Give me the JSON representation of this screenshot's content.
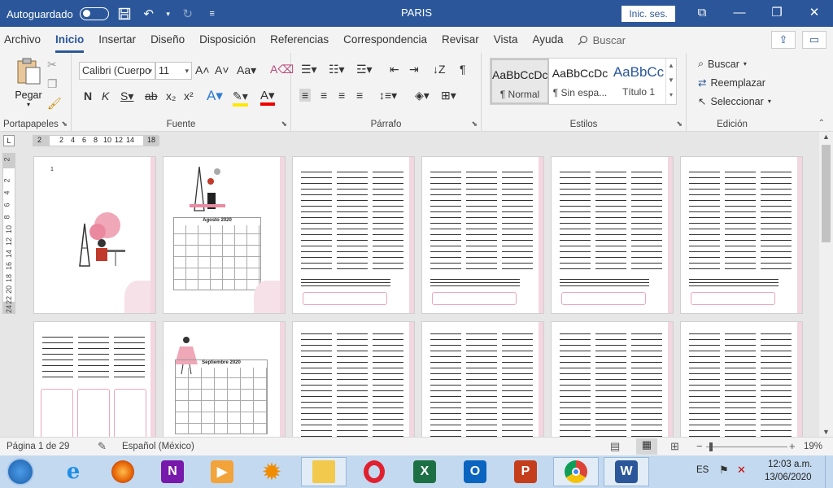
{
  "titlebar": {
    "autosave_label": "Autoguardado",
    "doc_title": "PARIS",
    "signin_label": "Inic. ses.",
    "min": "—",
    "restore": "❐",
    "close": "✕",
    "opts": "⧉"
  },
  "tabs": [
    "Archivo",
    "Inicio",
    "Insertar",
    "Diseño",
    "Disposición",
    "Referencias",
    "Correspondencia",
    "Revisar",
    "Vista",
    "Ayuda"
  ],
  "search_label": "Buscar",
  "ribbon": {
    "paste_label": "Pegar",
    "clipboard_group": "Portapapeles",
    "font_name": "Calibri (Cuerpo",
    "font_size": "11",
    "font_group": "Fuente",
    "paragraph_group": "Párrafo",
    "styles_group": "Estilos",
    "editing_group": "Edición",
    "styles": [
      {
        "preview": "AaBbCcDc",
        "name": "¶ Normal"
      },
      {
        "preview": "AaBbCcDc",
        "name": "¶ Sin espa..."
      },
      {
        "preview": "AaBbCc",
        "name": "Título 1"
      }
    ],
    "find_label": "Buscar",
    "replace_label": "Reemplazar",
    "select_label": "Seleccionar"
  },
  "ruler": {
    "ticks": [
      "2",
      "2",
      "4",
      "6",
      "8",
      "10",
      "12",
      "14",
      "18"
    ],
    "corner": "L"
  },
  "vruler_ticks": [
    "2",
    "2",
    "4",
    "6",
    "8",
    "10",
    "12",
    "14",
    "16",
    "18",
    "20",
    "22",
    "24"
  ],
  "pages": {
    "calendar1_title": "Agosto 2020",
    "calendar2_title": "Septiembre 2020",
    "page1_num": "1"
  },
  "status": {
    "page_info": "Página 1 de 29",
    "language": "Español (México)",
    "zoom": "19%"
  },
  "taskbar": {
    "lang": "ES",
    "time": "12:03 a.m.",
    "date": "13/06/2020"
  },
  "colors": {
    "word_blue": "#2b579a",
    "pink": "#f2d6e0"
  }
}
